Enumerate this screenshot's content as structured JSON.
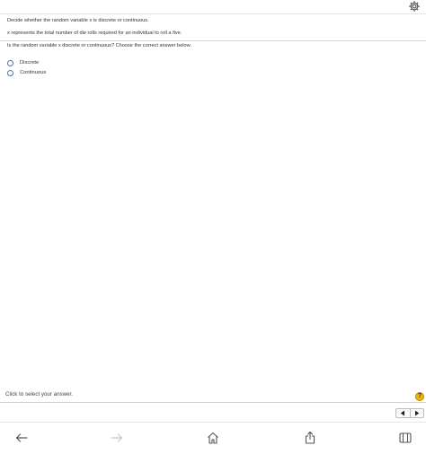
{
  "question": {
    "instruction": "Decide whether the random variable x is discrete or continuous.",
    "description": "x represents the total number of die rolls required for an individual to roll a five.",
    "prompt": "Is the random variable x discrete or continuous? Choose the correct answer below."
  },
  "options": [
    {
      "label": "Discrete",
      "selected": false
    },
    {
      "label": "Continuous",
      "selected": false
    }
  ],
  "footer": {
    "status_text": "Click to select your answer.",
    "help_label": "?"
  },
  "icons": {
    "settings": "gear-icon",
    "help": "help-icon",
    "prev": "triangle-left-icon",
    "next": "triangle-right-icon",
    "back": "arrow-left-icon",
    "forward": "arrow-right-icon",
    "home": "home-icon",
    "share": "share-icon",
    "tabs": "tabs-icon"
  },
  "colors": {
    "radio_border": "#5b6fa6",
    "help_badge": "#f2b705",
    "disabled_icon": "#c8c8c8",
    "active_icon": "#555555"
  }
}
